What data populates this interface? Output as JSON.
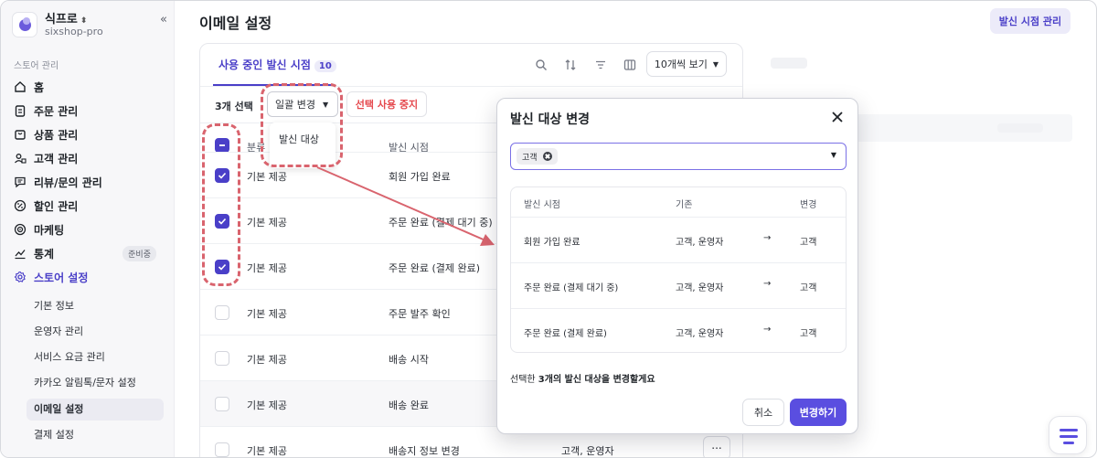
{
  "store": {
    "name": "식프로",
    "id": "sixshop-pro"
  },
  "sidebar": {
    "section_label": "스토어 관리",
    "items": [
      {
        "label": "홈",
        "icon": "home-icon"
      },
      {
        "label": "주문 관리",
        "icon": "clipboard-icon"
      },
      {
        "label": "상품 관리",
        "icon": "bag-icon"
      },
      {
        "label": "고객 관리",
        "icon": "users-icon"
      },
      {
        "label": "리뷰/문의 관리",
        "icon": "chat-icon"
      },
      {
        "label": "할인 관리",
        "icon": "discount-icon"
      },
      {
        "label": "마케팅",
        "icon": "target-icon"
      },
      {
        "label": "통계",
        "icon": "chart-icon",
        "badge": "준비중"
      },
      {
        "label": "스토어 설정",
        "icon": "gear-icon"
      }
    ],
    "sub_items": [
      "기본 정보",
      "운영자 관리",
      "서비스 요금 관리",
      "카카오 알림톡/문자 설정",
      "이메일 설정",
      "결제 설정"
    ]
  },
  "header": {
    "title": "이메일 설정",
    "action_label": "발신 시점 관리"
  },
  "tab": {
    "label": "사용 중인 발신 시점",
    "count": "10"
  },
  "toolbar": {
    "per_page": "10개씩 보기"
  },
  "bulk": {
    "selected": "3개 선택",
    "change_label": "일괄 변경",
    "stop_label": "선택 사용 중지",
    "menu_item": "발신 대상"
  },
  "table": {
    "headers": {
      "category": "분류",
      "timing": "발신 시점"
    },
    "rows": [
      {
        "category": "기본 제공",
        "timing": "회원 가입 완료",
        "checked": true
      },
      {
        "category": "기본 제공",
        "timing": "주문 완료 (결제 대기 중)",
        "checked": true
      },
      {
        "category": "기본 제공",
        "timing": "주문 완료 (결제 완료)",
        "checked": true
      },
      {
        "category": "기본 제공",
        "timing": "주문 발주 확인",
        "checked": false
      },
      {
        "category": "기본 제공",
        "timing": "배송 시작",
        "checked": false
      },
      {
        "category": "기본 제공",
        "timing": "배송 완료",
        "checked": false
      },
      {
        "category": "기본 제공",
        "timing": "배송지 정보 변경",
        "target": "고객, 운영자",
        "more": "...",
        "checked": false
      }
    ]
  },
  "modal": {
    "title": "발신 대상 변경",
    "chip": "고객",
    "headers": {
      "timing": "발신 시점",
      "before": "기존",
      "after": "변경"
    },
    "rows": [
      {
        "timing": "회원 가입 완료",
        "before": "고객, 운영자",
        "arrow": "→",
        "after": "고객"
      },
      {
        "timing": "주문 완료 (결제 대기 중)",
        "before": "고객, 운영자",
        "arrow": "→",
        "after": "고객"
      },
      {
        "timing": "주문 완료 (결제 완료)",
        "before": "고객, 운영자",
        "arrow": "→",
        "after": "고객"
      }
    ],
    "note_prefix": "선택한 ",
    "note_bold": "3개의 발신 대상을 변경할게요",
    "cancel_label": "취소",
    "confirm_label": "변경하기"
  },
  "colors": {
    "accent": "#5a4ee0",
    "danger": "#e5484d",
    "annotation": "#d9646e"
  }
}
